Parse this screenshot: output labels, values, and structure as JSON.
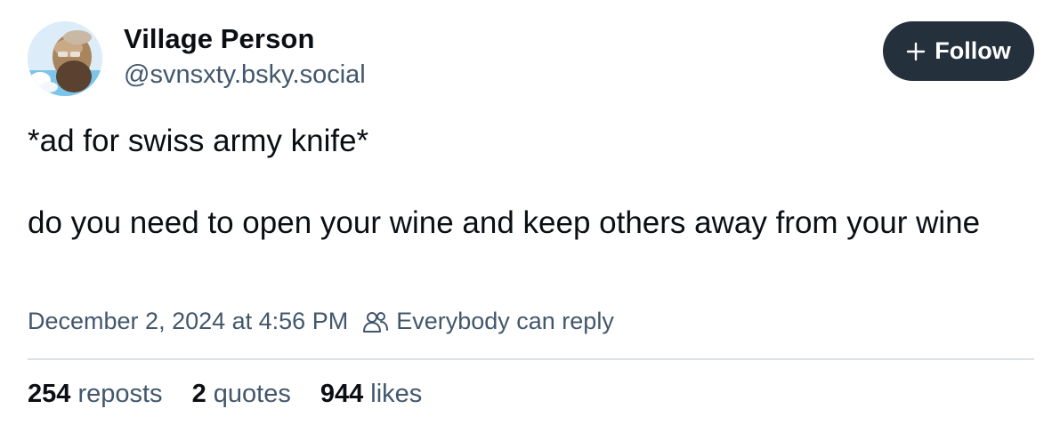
{
  "author": {
    "display_name": "Village Person",
    "handle": "@svnsxty.bsky.social",
    "avatar_icon": "bearded-man-avatar-icon"
  },
  "follow_button": {
    "icon": "plus-icon",
    "label": "Follow"
  },
  "post": {
    "paragraphs": [
      "*ad for swiss army knife*",
      "do you need to open your wine and keep others away from your wine"
    ]
  },
  "meta": {
    "timestamp": "December 2, 2024 at 4:56 PM",
    "reply_icon": "people-icon",
    "reply_setting": "Everybody can reply"
  },
  "stats": {
    "reposts": {
      "count": "254",
      "label": "reposts"
    },
    "quotes": {
      "count": "2",
      "label": "quotes"
    },
    "likes": {
      "count": "944",
      "label": "likes"
    }
  },
  "colors": {
    "button_bg": "#25303d",
    "secondary_text": "#42576c",
    "primary_text": "#0b0f14",
    "divider": "#dbe1e7"
  }
}
